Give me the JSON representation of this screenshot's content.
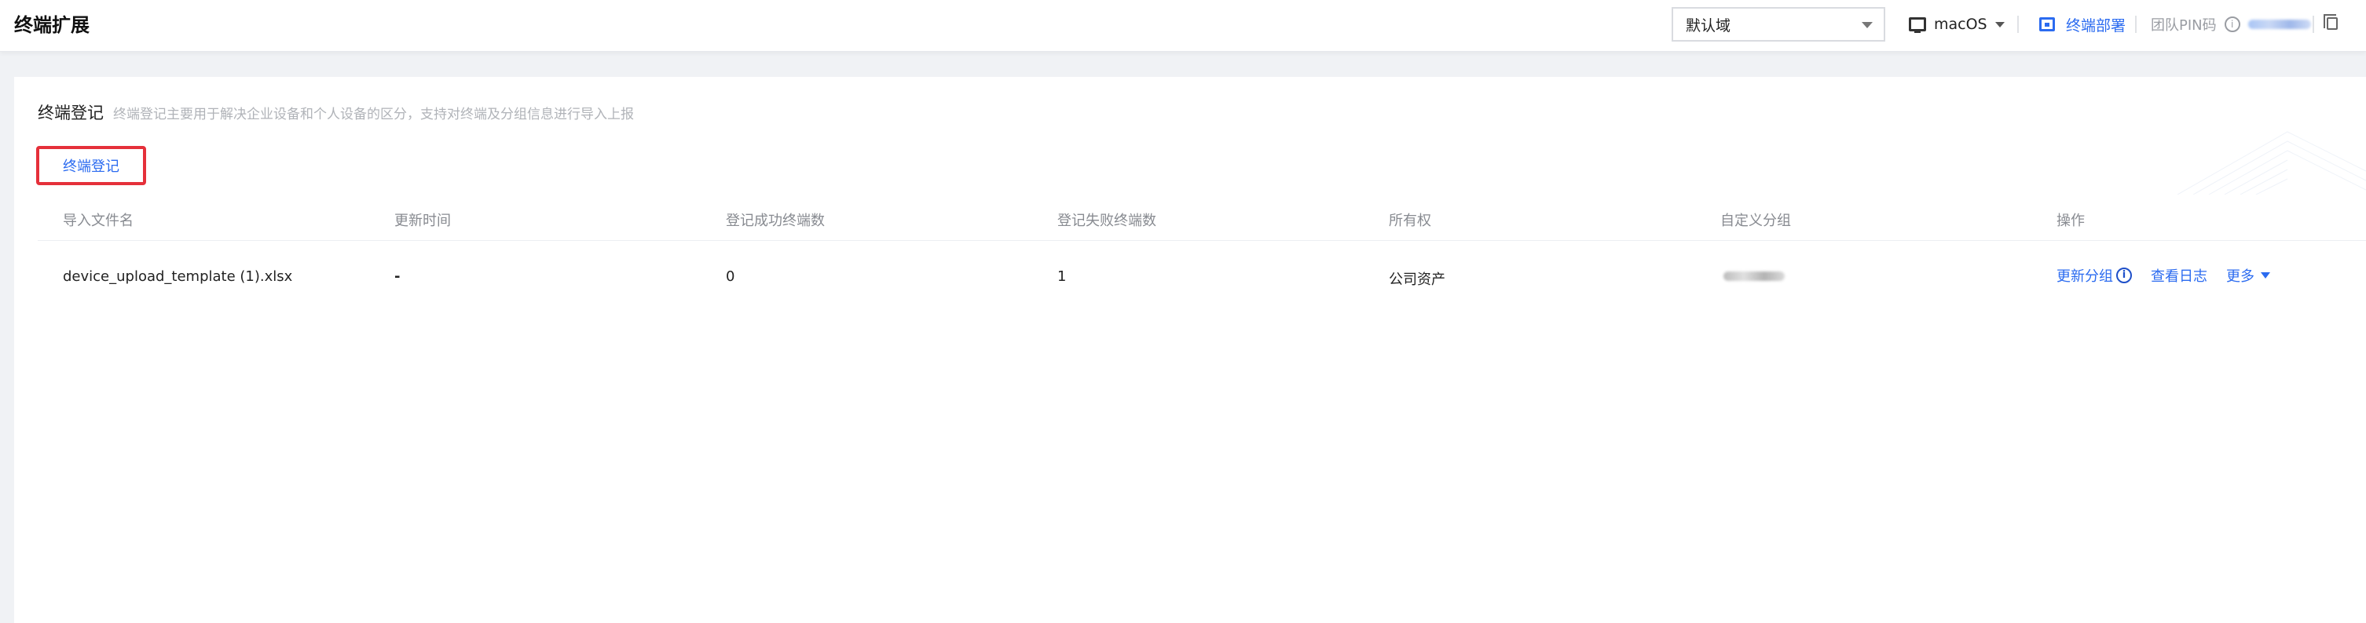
{
  "header": {
    "title": "终端扩展",
    "domain_select": {
      "value": "默认域"
    },
    "os_switch": {
      "label": "macOS"
    },
    "deploy_link": "终端部署",
    "team_pin_label": "团队PIN码"
  },
  "section": {
    "title": "终端登记",
    "description": "终端登记主要用于解决企业设备和个人设备的区分，支持对终端及分组信息进行导入上报",
    "register_button": "终端登记"
  },
  "table": {
    "columns": [
      "导入文件名",
      "更新时间",
      "登记成功终端数",
      "登记失败终端数",
      "所有权",
      "自定义分组",
      "操作"
    ],
    "rows": [
      {
        "file_name": "device_upload_template (1).xlsx",
        "update_time": "-",
        "success_count": "0",
        "fail_count": "1",
        "ownership": "公司资产"
      }
    ],
    "actions": {
      "update_group": "更新分组",
      "view_log": "查看日志",
      "more": "更多"
    }
  },
  "colors": {
    "accent": "#2b6bf0",
    "highlight_border": "#e5303a",
    "page_bg": "#f0f2f5"
  }
}
